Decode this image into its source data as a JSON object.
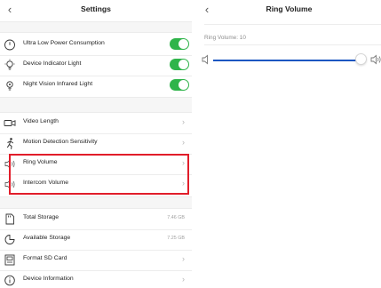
{
  "settings": {
    "title": "Settings",
    "toggles": [
      {
        "label": "Ultra Low Power Consumption",
        "on": true,
        "icon": "power-icon"
      },
      {
        "label": "Device Indicator Light",
        "on": true,
        "icon": "lightbulb-icon"
      },
      {
        "label": "Night Vision Infrared Light",
        "on": true,
        "icon": "infrared-bulb-icon"
      }
    ],
    "options": [
      {
        "label": "Video Length",
        "icon": "video-camera-icon"
      },
      {
        "label": "Motion Detection Sensitivity",
        "icon": "running-person-icon"
      },
      {
        "label": "Ring Volume",
        "icon": "speaker-icon"
      },
      {
        "label": "Intercom Volume",
        "icon": "speaker-icon"
      }
    ],
    "storage": [
      {
        "label": "Total Storage",
        "value": "7.46 GB",
        "icon": "sd-card-icon"
      },
      {
        "label": "Available Storage",
        "value": "7.25 GB",
        "icon": "pie-chart-icon"
      },
      {
        "label": "Format SD Card",
        "icon": "format-icon"
      },
      {
        "label": "Device Information",
        "icon": "info-icon"
      }
    ]
  },
  "ring_volume": {
    "title": "Ring Volume",
    "label": "Ring Volume: 10",
    "level": 10,
    "max": 10
  },
  "colors": {
    "toggle_on": "#2fb44a",
    "slider_accent": "#1b57c2",
    "highlight": "#e11d2a"
  }
}
